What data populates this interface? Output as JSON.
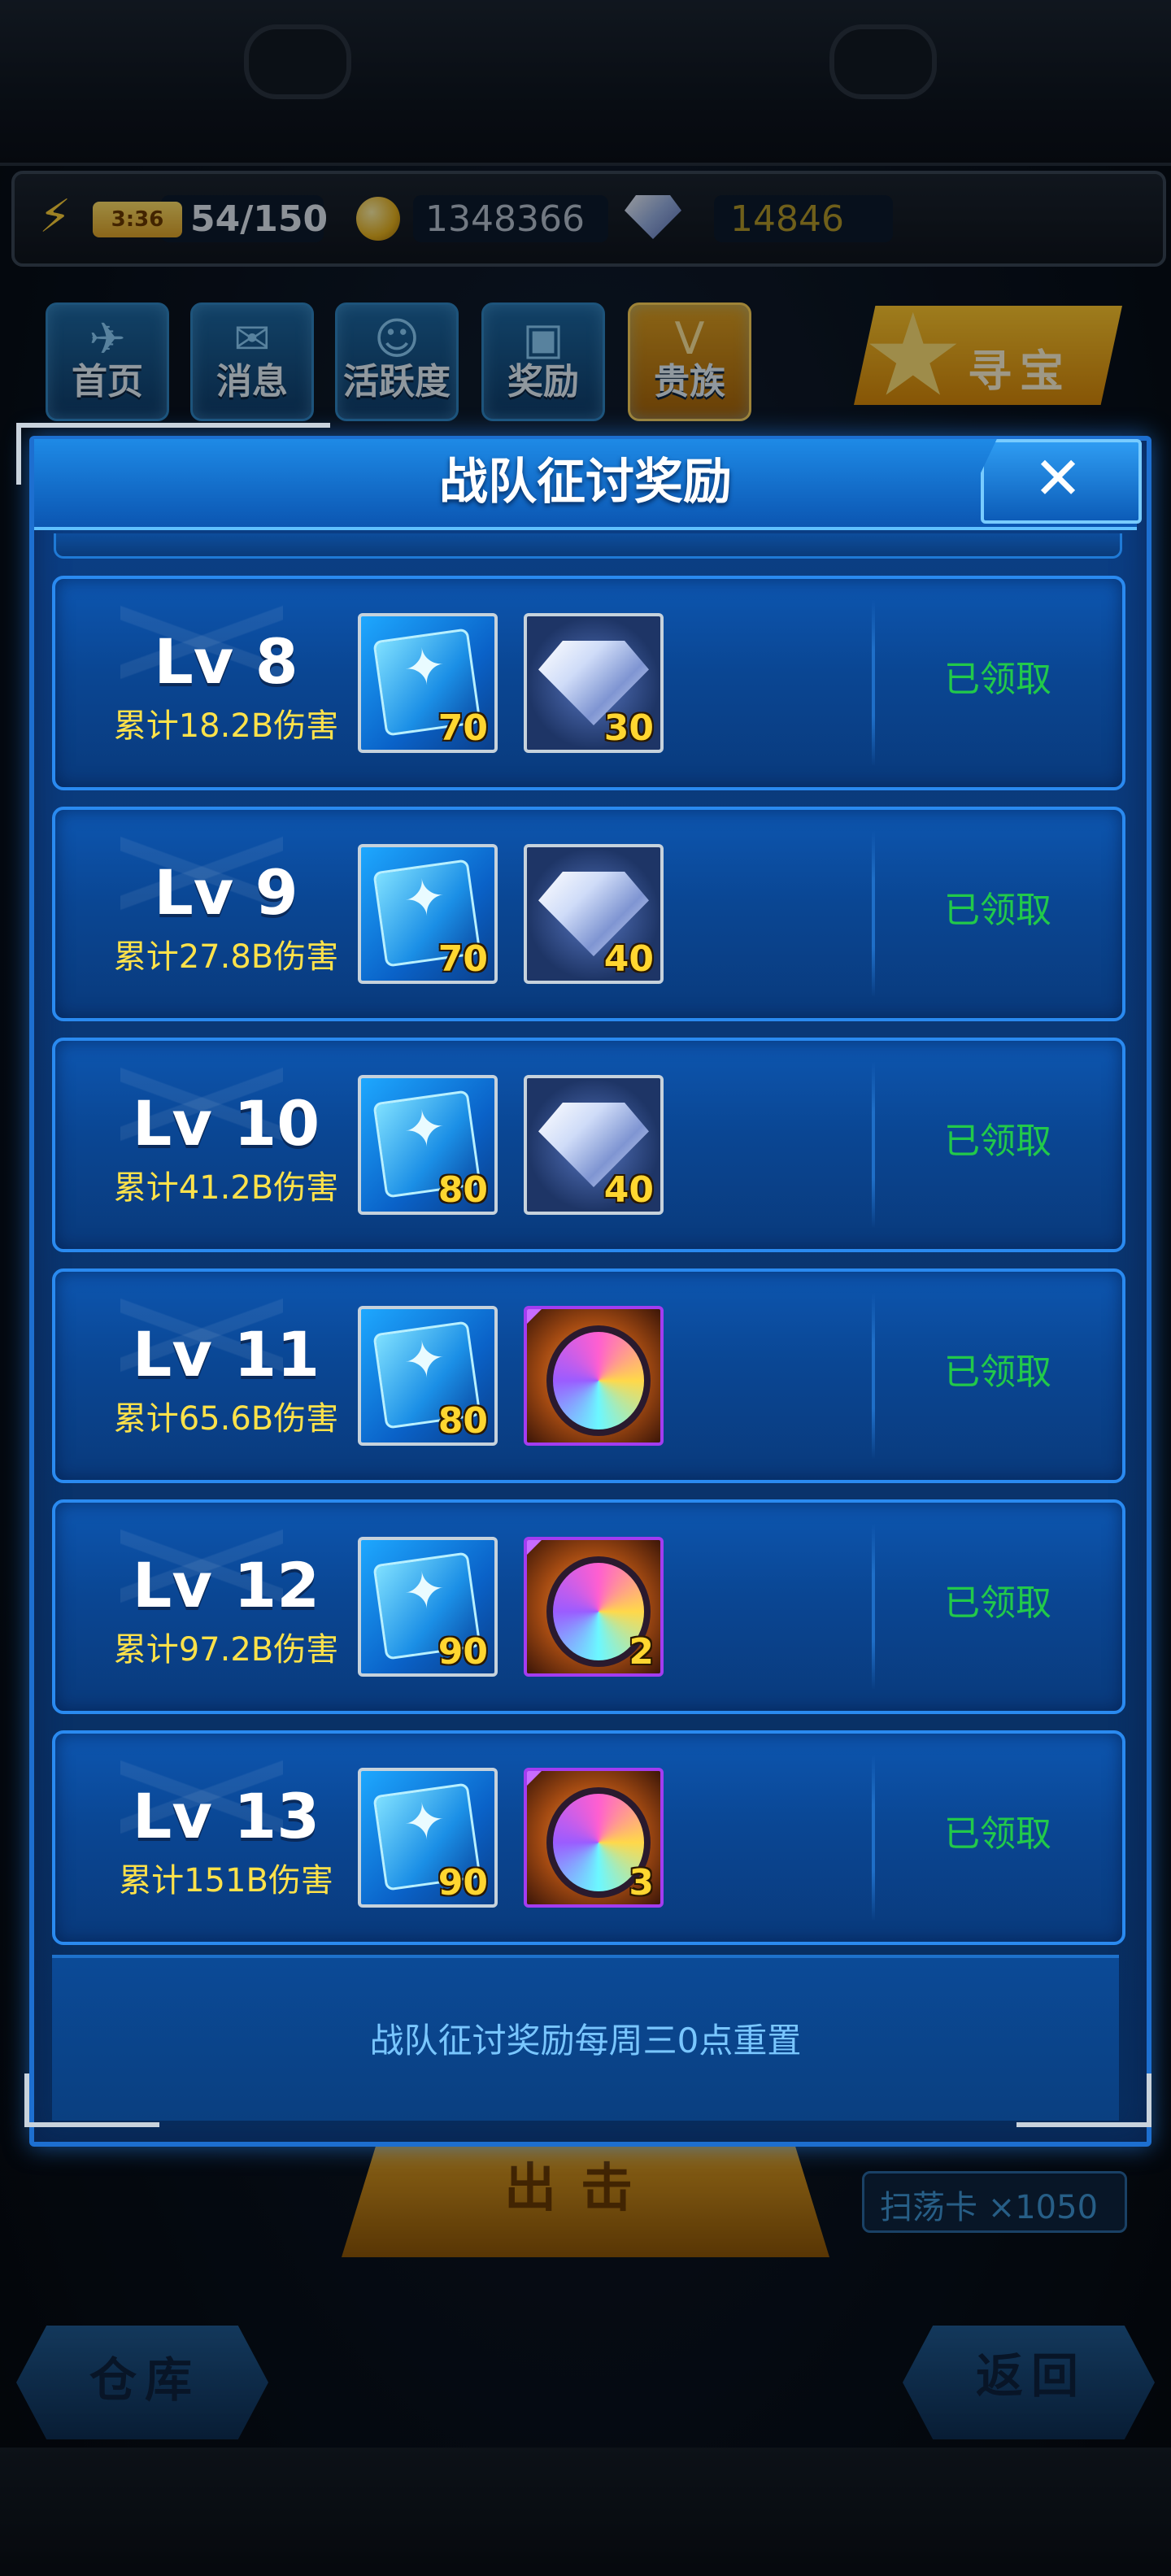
{
  "resources": {
    "energy_timer": "3:36",
    "energy_value": "54/150",
    "coins": "1348366",
    "gems": "14846"
  },
  "nav": [
    {
      "label": "首页"
    },
    {
      "label": "消息"
    },
    {
      "label": "活跃度"
    },
    {
      "label": "奖励"
    },
    {
      "label": "贵族"
    }
  ],
  "treasure_label": "寻宝",
  "modal": {
    "title": "战队征讨奖励",
    "close_glyph": "✕",
    "footer_note": "战队征讨奖励每周三0点重置",
    "rows": [
      {
        "level": "Lv 8",
        "damage": "累计18.2B伤害",
        "items": [
          {
            "kind": "card",
            "count": "70"
          },
          {
            "kind": "diamond",
            "count": "30"
          }
        ],
        "status": "已领取"
      },
      {
        "level": "Lv 9",
        "damage": "累计27.8B伤害",
        "items": [
          {
            "kind": "card",
            "count": "70"
          },
          {
            "kind": "diamond",
            "count": "40"
          }
        ],
        "status": "已领取"
      },
      {
        "level": "Lv 10",
        "damage": "累计41.2B伤害",
        "items": [
          {
            "kind": "card",
            "count": "80"
          },
          {
            "kind": "diamond",
            "count": "40"
          }
        ],
        "status": "已领取"
      },
      {
        "level": "Lv 11",
        "damage": "累计65.6B伤害",
        "items": [
          {
            "kind": "card",
            "count": "80"
          },
          {
            "kind": "core",
            "count": ""
          }
        ],
        "status": "已领取"
      },
      {
        "level": "Lv 12",
        "damage": "累计97.2B伤害",
        "items": [
          {
            "kind": "card",
            "count": "90"
          },
          {
            "kind": "core",
            "count": "2"
          }
        ],
        "status": "已领取"
      },
      {
        "level": "Lv 13",
        "damage": "累计151B伤害",
        "items": [
          {
            "kind": "card",
            "count": "90"
          },
          {
            "kind": "core",
            "count": "3"
          }
        ],
        "status": "已领取"
      }
    ]
  },
  "bottom": {
    "attack_label": "出击",
    "sweep_card": "扫荡卡 ×1050",
    "warehouse_label": "仓库",
    "back_label": "返回"
  },
  "icons": {
    "energy": "lightning-icon",
    "coin": "coin-icon",
    "gem": "gem-icon",
    "close": "close-icon"
  },
  "colors": {
    "status_claimed": "#22c94a",
    "damage_text": "#ffe24a",
    "footer_note": "#79c6ff",
    "count_text": "#ffd630"
  }
}
